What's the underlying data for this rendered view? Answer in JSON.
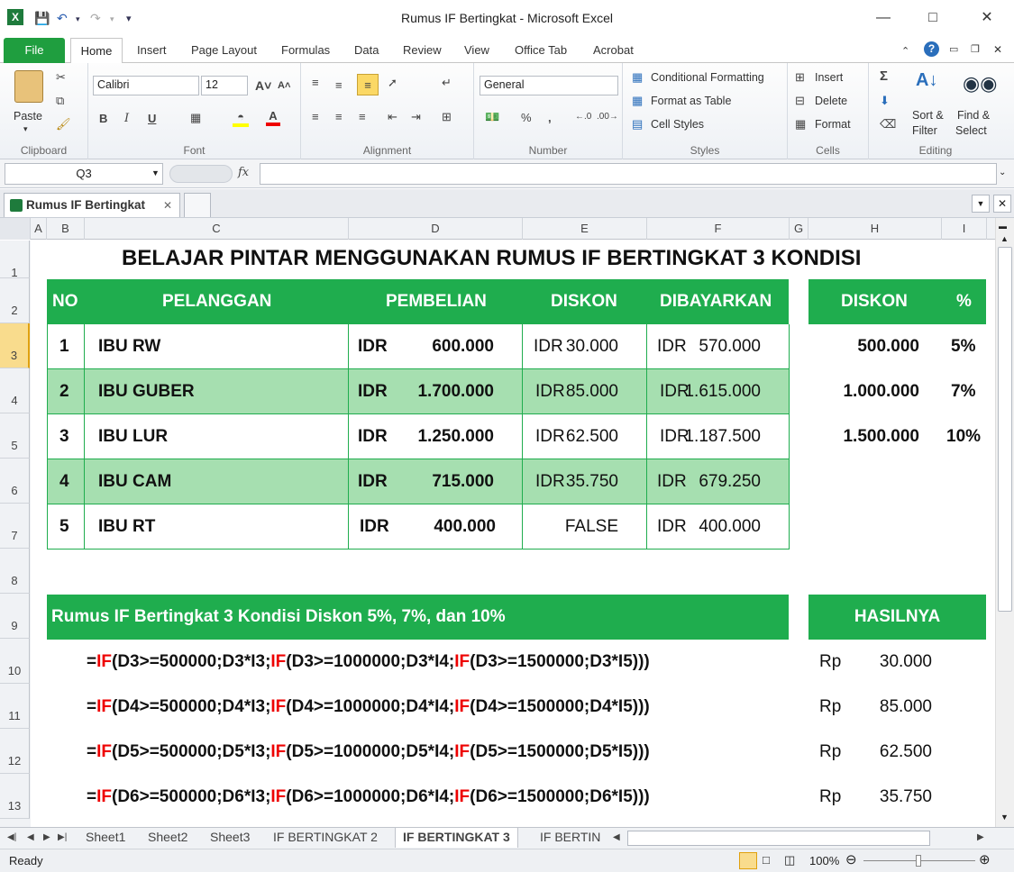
{
  "window": {
    "title": "Rumus IF Bertingkat - Microsoft Excel"
  },
  "ribbon": {
    "file": "File",
    "tabs": [
      "Home",
      "Insert",
      "Page Layout",
      "Formulas",
      "Data",
      "Review",
      "View",
      "Office Tab",
      "Acrobat"
    ],
    "clipboard": {
      "paste": "Paste",
      "label": "Clipboard"
    },
    "font": {
      "name": "Calibri",
      "size": "12",
      "label": "Font",
      "bold": "B",
      "italic": "I",
      "underline": "U"
    },
    "alignment": {
      "label": "Alignment"
    },
    "number": {
      "format": "General",
      "label": "Number",
      "percent": "%",
      "comma": ","
    },
    "styles": {
      "conditional": "Conditional Formatting",
      "table": "Format as Table",
      "cell": "Cell Styles",
      "label": "Styles"
    },
    "cells": {
      "insert": "Insert",
      "delete": "Delete",
      "format": "Format",
      "label": "Cells"
    },
    "editing": {
      "sort": "Sort &",
      "filter": "Filter",
      "find": "Find &",
      "select": "Select",
      "label": "Editing",
      "sigma": "Σ"
    }
  },
  "formula_bar": {
    "name_box": "Q3",
    "fx": "fx",
    "value": ""
  },
  "doc_tab": {
    "label": "Rumus IF Bertingkat"
  },
  "columns": [
    "A",
    "B",
    "C",
    "D",
    "E",
    "F",
    "G",
    "H",
    "I"
  ],
  "rows": [
    "1",
    "2",
    "3",
    "4",
    "5",
    "6",
    "7",
    "8",
    "9",
    "10",
    "11",
    "12",
    "13"
  ],
  "sheet": {
    "title": "BELAJAR PINTAR MENGGUNAKAN RUMUS IF BERTINGKAT 3 KONDISI",
    "headers": {
      "no": "NO",
      "pelanggan": "PELANGGAN",
      "pembelian": "PEMBELIAN",
      "diskon": "DISKON",
      "dibayarkan": "DIBAYARKAN"
    },
    "rows": [
      {
        "no": "1",
        "name": "IBU RW",
        "cur": "IDR",
        "amount": "600.000",
        "dcur": "IDR",
        "disc": "30.000",
        "pcur": "IDR",
        "paid": "570.000"
      },
      {
        "no": "2",
        "name": "IBU GUBER",
        "cur": "IDR",
        "amount": "1.700.000",
        "dcur": "IDR",
        "disc": "85.000",
        "pcur": "IDR",
        "paid": "1.615.000"
      },
      {
        "no": "3",
        "name": "IBU LUR",
        "cur": "IDR",
        "amount": "1.250.000",
        "dcur": "IDR",
        "disc": "62.500",
        "pcur": "IDR",
        "paid": "1.187.500"
      },
      {
        "no": "4",
        "name": "IBU CAM",
        "cur": "IDR",
        "amount": "715.000",
        "dcur": "IDR",
        "disc": "35.750",
        "pcur": "IDR",
        "paid": "679.250"
      },
      {
        "no": "5",
        "name": "IBU RT",
        "cur": "IDR",
        "amount": "400.000",
        "dcur": "",
        "disc": "FALSE",
        "pcur": "IDR",
        "paid": "400.000"
      }
    ],
    "side_headers": {
      "diskon": "DISKON",
      "pct": "%"
    },
    "tiers": [
      {
        "threshold": "500.000",
        "pct": "5%"
      },
      {
        "threshold": "1.000.000",
        "pct": "7%"
      },
      {
        "threshold": "1.500.000",
        "pct": "10%"
      }
    ],
    "formula_header": "Rumus IF Bertingkat 3 Kondisi Diskon 5%, 7%, dan 10%",
    "result_header": "HASILNYA",
    "formulas": [
      {
        "eq": "=",
        "a": "IF",
        "b": "(D3>=500000;D3*I3;",
        "c": "IF",
        "d": "(D3>=1000000;D3*I4;",
        "e": "IF",
        "f": "(D3>=1500000;D3*I5)))",
        "rp": "Rp",
        "res": "30.000"
      },
      {
        "eq": "=",
        "a": "IF",
        "b": "(D4>=500000;D4*I3;",
        "c": "IF",
        "d": "(D4>=1000000;D4*I4;",
        "e": "IF",
        "f": "(D4>=1500000;D4*I5)))",
        "rp": "Rp",
        "res": "85.000"
      },
      {
        "eq": "=",
        "a": "IF",
        "b": "(D5>=500000;D5*I3;",
        "c": "IF",
        "d": "(D5>=1000000;D5*I4;",
        "e": "IF",
        "f": "(D5>=1500000;D5*I5)))",
        "rp": "Rp",
        "res": "62.500"
      },
      {
        "eq": "=",
        "a": "IF",
        "b": "(D6>=500000;D6*I3;",
        "c": "IF",
        "d": "(D6>=1000000;D6*I4;",
        "e": "IF",
        "f": "(D6>=1500000;D6*I5)))",
        "rp": "Rp",
        "res": "35.750"
      }
    ]
  },
  "sheet_tabs": [
    "Sheet1",
    "Sheet2",
    "Sheet3",
    "IF BERTINGKAT 2",
    "IF BERTINGKAT 3",
    "IF BERTIN"
  ],
  "status": {
    "ready": "Ready",
    "zoom": "100%"
  },
  "colors": {
    "green": "#1fad4e",
    "light_green": "#a6dfb0"
  }
}
